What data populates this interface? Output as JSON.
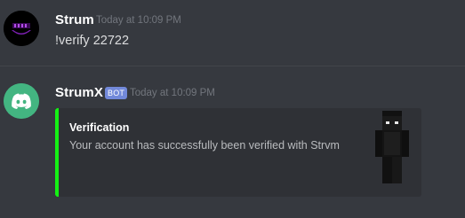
{
  "messages": [
    {
      "username": "Strum",
      "timestamp": "Today at 10:09 PM",
      "avatar_icon": "strum-logo-avatar",
      "content": "!verify 22722"
    },
    {
      "username": "StrumX",
      "bot_tag": "BOT",
      "timestamp": "Today at 10:09 PM",
      "avatar_icon": "discord-logo-avatar",
      "embed": {
        "accent_color": "#14f114",
        "title": "Verification",
        "description": "Your account has successfully been verified with Strvm",
        "thumbnail_icon": "minecraft-skin-icon"
      }
    }
  ],
  "colors": {
    "background": "#36393f",
    "embed_background": "#2f3136",
    "bot_tag": "#7289da",
    "discord_avatar": "#43b581",
    "timestamp": "#72767d"
  }
}
